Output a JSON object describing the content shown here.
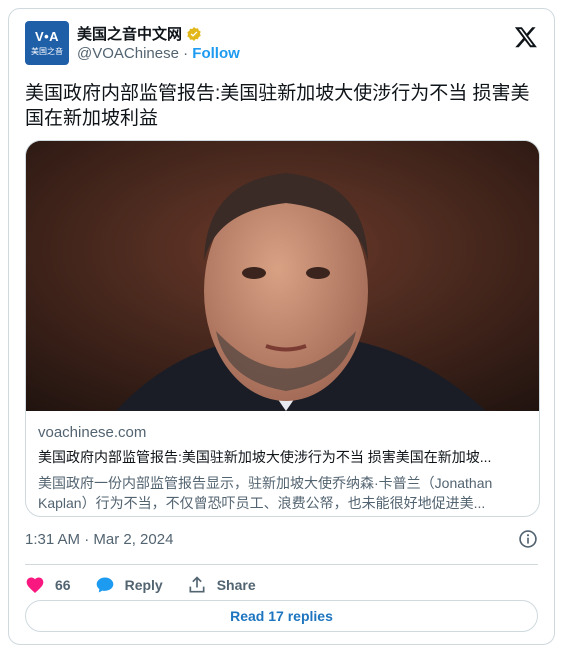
{
  "account": {
    "avatar_text_top": "V•A",
    "avatar_text_bottom": "美国之音",
    "display_name": "美国之音中文网",
    "handle": "@VOAChinese",
    "separator": "·",
    "follow_label": "Follow",
    "brand_color": "#1f5fa8",
    "verified_color": "#e2b719"
  },
  "tweet": {
    "text": "美国政府内部监管报告:美国驻新加坡大使涉行为不当 损害美国在新加坡利益",
    "timestamp": "1:31 AM · Mar 2, 2024"
  },
  "link_card": {
    "domain": "voachinese.com",
    "title": "美国政府内部监管报告:美国驻新加坡大使涉行为不当 损害美国在新加坡...",
    "description": "美国政府一份内部监管报告显示，驻新加坡大使乔纳森·卡普兰（Jonathan Kaplan）行为不当，不仅曾恐吓员工、浪费公帑，也未能很好地促进美..."
  },
  "actions": {
    "like_count": "66",
    "reply_label": "Reply",
    "share_label": "Share",
    "read_replies_label": "Read 17 replies",
    "like_color": "#f91880",
    "accent_color": "#1d9bf0"
  }
}
